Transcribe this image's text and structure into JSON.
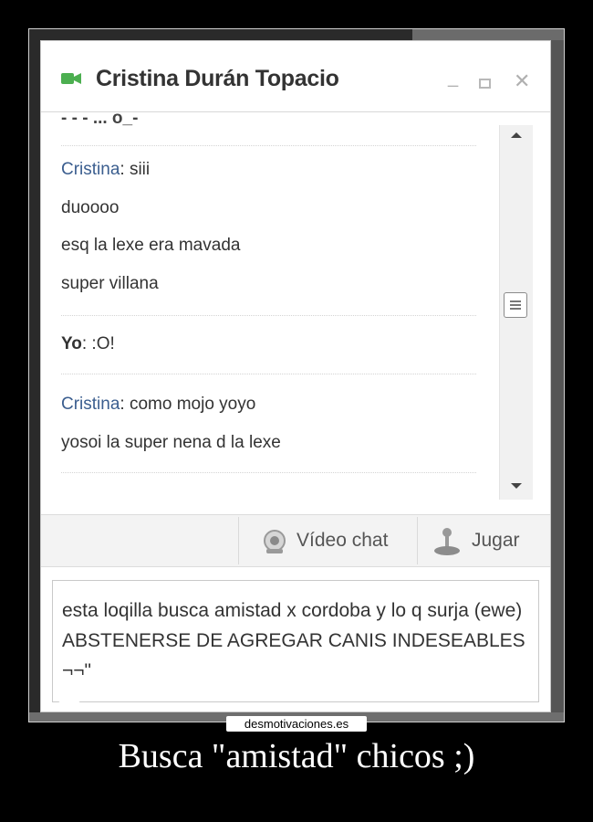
{
  "window": {
    "title": "Cristina Durán Topacio",
    "minimize_glyph": "_",
    "close_glyph": "✕"
  },
  "messages": {
    "top_fragment": "- - - ... o_-",
    "block1": {
      "sender": "Cristina",
      "first": ": siii",
      "lines": [
        "duoooo",
        "esq la lexe era mavada",
        "super villana"
      ]
    },
    "block2": {
      "sender": "Yo",
      "first": ": :O!"
    },
    "block3": {
      "sender": "Cristina",
      "first": ": como mojo yoyo",
      "lines": [
        "yosoi la super nena d la lexe"
      ]
    }
  },
  "actions": {
    "video_chat_label": "Vídeo chat",
    "game_label": "Jugar"
  },
  "composer": {
    "text": "esta loqilla busca amistad x cordoba y lo q surja (ewe) ABSTENERSE DE AGREGAR CANIS INDESEABLES ¬¬\""
  },
  "poster": {
    "watermark": "desmotivaciones.es",
    "caption": "Busca \"amistad\" chicos ;)"
  },
  "colors": {
    "sender_name": "#3b5e8f",
    "camera_icon": "#4caf50",
    "background": "#000000"
  }
}
